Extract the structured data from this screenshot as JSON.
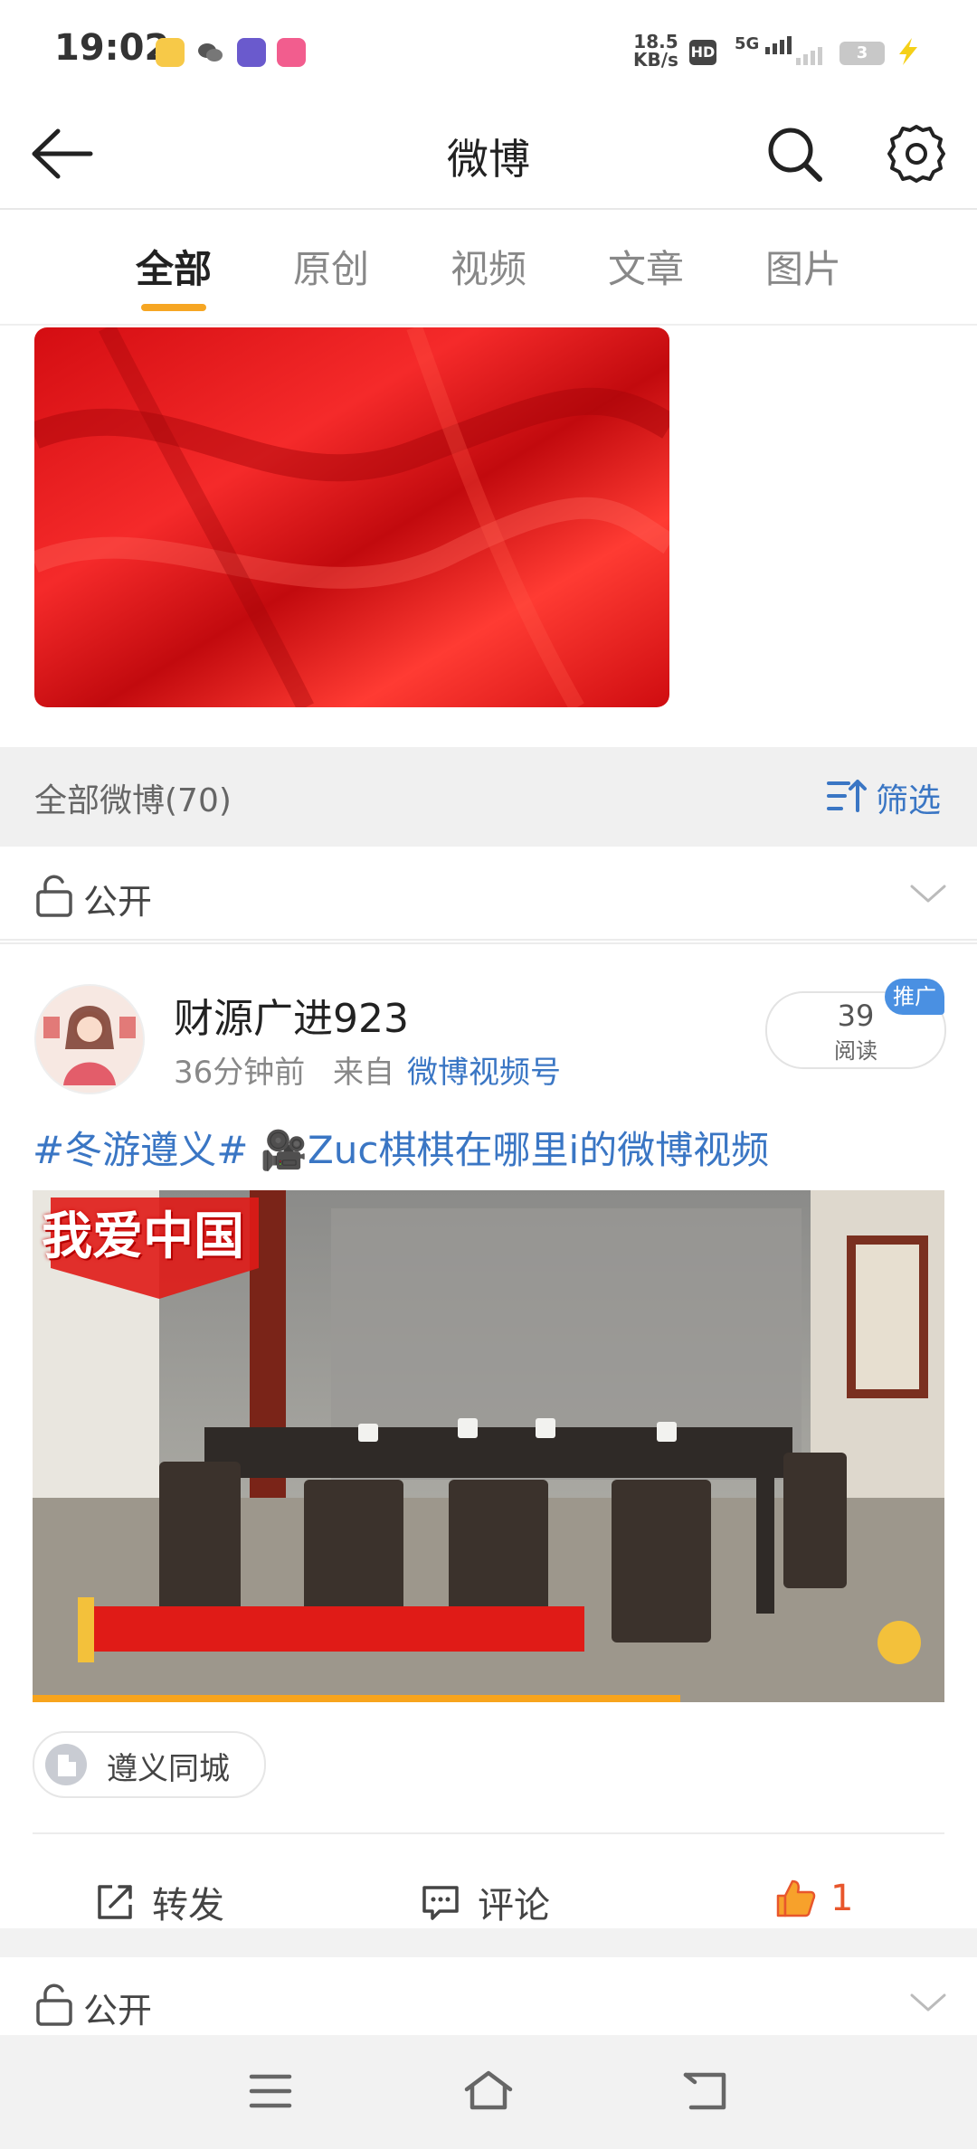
{
  "status_bar": {
    "time": "19:02",
    "net_speed_top": "18.5",
    "net_speed_bottom": "KB/s",
    "hd": "HD",
    "network": "5G",
    "battery": "3"
  },
  "header": {
    "title": "微博"
  },
  "tabs": [
    {
      "label": "全部",
      "active": true
    },
    {
      "label": "原创",
      "active": false
    },
    {
      "label": "视频",
      "active": false
    },
    {
      "label": "文章",
      "active": false
    },
    {
      "label": "图片",
      "active": false
    }
  ],
  "filter_bar": {
    "all_label": "全部微博(70)",
    "filter_label": "筛选"
  },
  "visibility": {
    "label": "公开"
  },
  "post": {
    "author": "财源广进923",
    "time": "36分钟前",
    "from": "来自",
    "source": "微博视频号",
    "read_count": "39",
    "read_label": "阅读",
    "promo_label": "推广",
    "text": "#冬游遵义# 🎥Zuc棋棋在哪里i的微博视频",
    "video_overlay": "我爱中国",
    "video_progress": 0.71,
    "location": "遵义同城",
    "actions": {
      "repost": "转发",
      "comment": "评论",
      "likes": "1"
    }
  },
  "colors": {
    "accent_tab": "#f6a623",
    "link_blue": "#3a76c4",
    "like_orange": "#e8562c",
    "promo_blue": "#4a90e2"
  }
}
